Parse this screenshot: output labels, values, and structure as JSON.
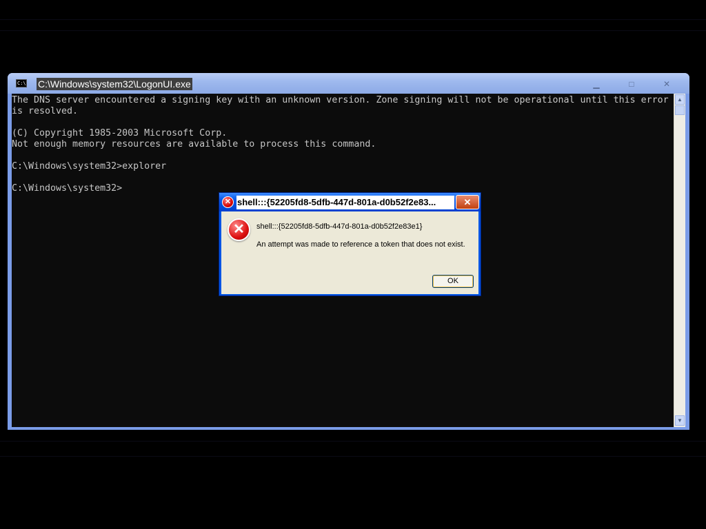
{
  "console": {
    "title": "C:\\Windows\\system32\\LogonUI.exe",
    "icon_label": "C:\\",
    "controls": {
      "minimize": "▁",
      "maximize": "□",
      "close": "✕"
    },
    "lines": [
      "The DNS server encountered a signing key with an unknown version. Zone signing will not be operational until this error",
      "is resolved.",
      "",
      "(C) Copyright 1985-2003 Microsoft Corp.",
      "Not enough memory resources are available to process this command.",
      "",
      "C:\\Windows\\system32>explorer",
      "",
      "C:\\Windows\\system32>"
    ]
  },
  "dialog": {
    "title": "shell:::{52205fd8-5dfb-447d-801a-d0b52f2e83...",
    "path": "shell:::{52205fd8-5dfb-447d-801a-d0b52f2e83e1}",
    "message": "An attempt was made to reference a token that does not exist.",
    "ok_label": "OK",
    "close_glyph": "✕"
  },
  "colors": {
    "console_bg": "#0c0c0c",
    "console_text": "#c6c6c6",
    "dialog_title_blue": "#0054e3",
    "dialog_face": "#ece9d8",
    "error_red": "#d40000"
  }
}
